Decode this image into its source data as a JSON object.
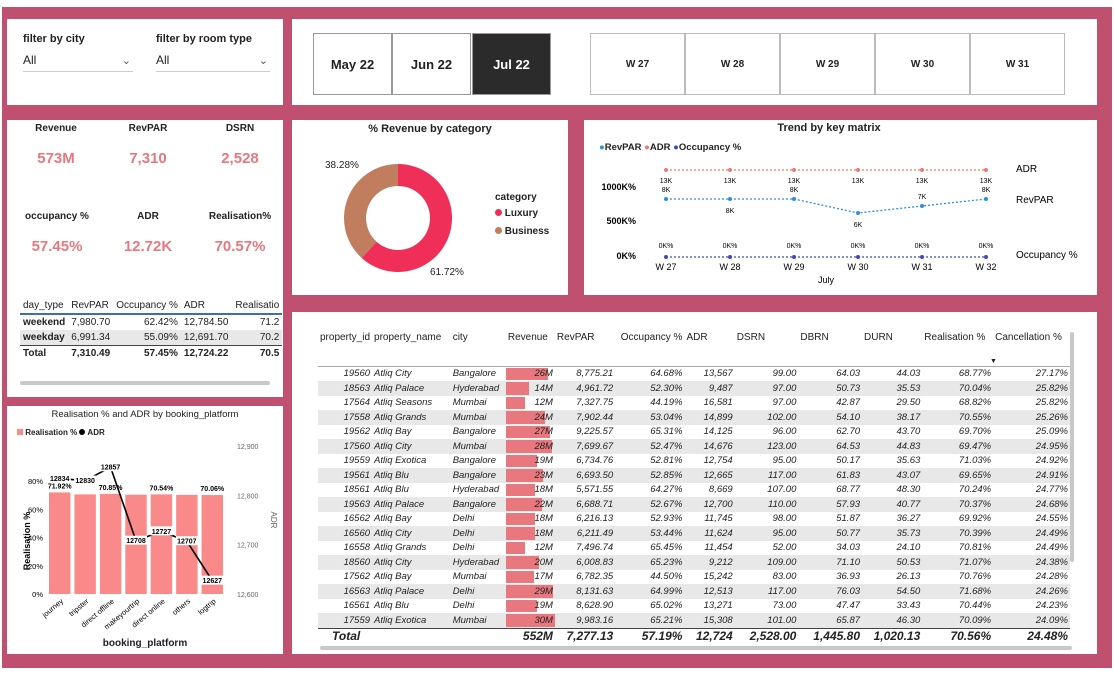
{
  "filters": {
    "city_label": "filter by city",
    "city_value": "All",
    "room_label": "filter by room type",
    "room_value": "All"
  },
  "months": [
    "May 22",
    "Jun 22",
    "Jul 22"
  ],
  "selected_month": "Jul 22",
  "weeks": [
    "W 27",
    "W 28",
    "W 29",
    "W 30",
    "W 31"
  ],
  "kpis": [
    {
      "label": "Revenue",
      "value": "573M"
    },
    {
      "label": "RevPAR",
      "value": "7,310"
    },
    {
      "label": "DSRN",
      "value": "2,528"
    },
    {
      "label": "occupancy %",
      "value": "57.45%"
    },
    {
      "label": "ADR",
      "value": "12.72K"
    },
    {
      "label": "Realisation%",
      "value": "70.57%"
    }
  ],
  "day_type_table": {
    "headers": [
      "day_type",
      "RevPAR",
      "Occupancy %",
      "ADR",
      "Realisatio"
    ],
    "rows": [
      [
        "weekend",
        "7,980.70",
        "62.42%",
        "12,784.50",
        "71.2"
      ],
      [
        "weekday",
        "6,991.34",
        "55.09%",
        "12,691.70",
        "70.2"
      ],
      [
        "Total",
        "7,310.49",
        "57.45%",
        "12,724.22",
        "70.5"
      ]
    ]
  },
  "donut": {
    "title": "% Revenue by category",
    "legend_title": "category",
    "legend": [
      {
        "name": "Luxury",
        "color": "#ef2f58"
      },
      {
        "name": "Business",
        "color": "#c07e5e"
      }
    ],
    "label_business": "38.28%",
    "label_luxury": "61.72%"
  },
  "trend": {
    "title": "Trend by key matrix",
    "legend": [
      {
        "name": "RevPAR",
        "color": "#2b8fe0"
      },
      {
        "name": "ADR",
        "color": "#f07a70"
      },
      {
        "name": "Occupancy %",
        "color": "#3b4dbd"
      }
    ],
    "y_ticks": [
      "1000K%",
      "500K%",
      "0K%"
    ],
    "x_title": "July",
    "right_labels": [
      "ADR",
      "RevPAR",
      "Occupancy %"
    ],
    "adr_labels": [
      "13K",
      "13K",
      "13K",
      "13K",
      "13K",
      "13K"
    ],
    "revpar_labels": [
      "8K",
      "8K",
      "8K",
      "6K",
      "7K",
      "8K"
    ],
    "occ_labels": [
      "0K%",
      "0K%",
      "0K%",
      "0K%",
      "0K%",
      "0K%"
    ]
  },
  "combo": {
    "title": "Realisation % and ADR by booking_platform",
    "legend": [
      {
        "name": "Realisation %",
        "color": "#f98a89"
      },
      {
        "name": "ADR",
        "color": "#000000"
      }
    ],
    "y_ticks": [
      "80%",
      "60%",
      "40%",
      "20%",
      "0%"
    ],
    "y2_ticks": [
      "12,900",
      "12,800",
      "12,700",
      "12,600"
    ],
    "ylabel": "Realisation %",
    "y2label": "ADR",
    "xlabel": "booking_platform",
    "top_labels": [
      "71.92%",
      "70.85%",
      "70.54%",
      "70.06%"
    ],
    "adr_labels": [
      "12834",
      "12830",
      "12857",
      "12708",
      "12727",
      "12707",
      "12627"
    ]
  },
  "chart_data": [
    {
      "type": "pie",
      "title": "% Revenue by category",
      "categories": [
        "Luxury",
        "Business"
      ],
      "values": [
        61.72,
        38.28
      ]
    },
    {
      "type": "line",
      "title": "Trend by key matrix",
      "categories": [
        "W 27",
        "W 28",
        "W 29",
        "W 30",
        "W 31",
        "W 32"
      ],
      "series": [
        {
          "name": "ADR",
          "values": [
            13000,
            13000,
            13000,
            13000,
            13000,
            13000
          ]
        },
        {
          "name": "RevPAR",
          "values": [
            8000,
            8000,
            8000,
            6000,
            7000,
            8000
          ]
        },
        {
          "name": "Occupancy %",
          "values": [
            0,
            0,
            0,
            0,
            0,
            0
          ]
        }
      ],
      "xlabel": "July"
    },
    {
      "type": "bar",
      "title": "Realisation % and ADR by booking_platform",
      "categories": [
        "journey",
        "tripster",
        "direct offline",
        "makeyourtrip",
        "direct online",
        "others",
        "logtrip"
      ],
      "series": [
        {
          "name": "Realisation %",
          "values": [
            71.92,
            70.5,
            70.85,
            70.3,
            70.54,
            70.2,
            70.06
          ]
        },
        {
          "name": "ADR",
          "values": [
            12834,
            12830,
            12857,
            12708,
            12727,
            12707,
            12627
          ]
        }
      ],
      "xlabel": "booking_platform",
      "ylabel": "Realisation %",
      "ylim": [
        0,
        80
      ],
      "y2lim": [
        12600,
        12900
      ]
    }
  ],
  "property_table": {
    "headers": [
      "property_id",
      "property_name",
      "city",
      "Revenue",
      "RevPAR",
      "Occupancy %",
      "ADR",
      "DSRN",
      "DBRN",
      "DURN",
      "Realisation %",
      "Cancellation %"
    ],
    "rows": [
      [
        "19560",
        "Atliq City",
        "Bangalore",
        "26M",
        "8,775.21",
        "64.68%",
        "13,567",
        "99.00",
        "64.03",
        "44.03",
        "68.77%",
        "27.17%"
      ],
      [
        "18563",
        "Atliq Palace",
        "Hyderabad",
        "14M",
        "4,961.72",
        "52.30%",
        "9,487",
        "97.00",
        "50.73",
        "35.53",
        "70.04%",
        "25.82%"
      ],
      [
        "17564",
        "Atliq Seasons",
        "Mumbai",
        "12M",
        "7,327.75",
        "44.19%",
        "16,581",
        "97.00",
        "42.87",
        "29.50",
        "68.82%",
        "25.82%"
      ],
      [
        "17558",
        "Atliq Grands",
        "Mumbai",
        "24M",
        "7,902.44",
        "53.04%",
        "14,899",
        "102.00",
        "54.10",
        "38.17",
        "70.55%",
        "25.26%"
      ],
      [
        "19562",
        "Atliq Bay",
        "Bangalore",
        "27M",
        "9,225.57",
        "65.31%",
        "14,125",
        "96.00",
        "62.70",
        "43.70",
        "69.70%",
        "25.09%"
      ],
      [
        "17560",
        "Atliq City",
        "Mumbai",
        "28M",
        "7,699.67",
        "52.47%",
        "14,676",
        "123.00",
        "64.53",
        "44.83",
        "69.47%",
        "24.95%"
      ],
      [
        "19559",
        "Atliq Exotica",
        "Bangalore",
        "19M",
        "6,734.76",
        "52.81%",
        "12,754",
        "95.00",
        "50.17",
        "35.63",
        "71.03%",
        "24.92%"
      ],
      [
        "19561",
        "Atliq Blu",
        "Bangalore",
        "23M",
        "6,693.50",
        "52.85%",
        "12,665",
        "117.00",
        "61.83",
        "43.07",
        "69.65%",
        "24.91%"
      ],
      [
        "18561",
        "Atliq Blu",
        "Hyderabad",
        "18M",
        "5,571.55",
        "64.27%",
        "8,669",
        "107.00",
        "68.77",
        "48.30",
        "70.24%",
        "24.77%"
      ],
      [
        "19563",
        "Atliq Palace",
        "Bangalore",
        "22M",
        "6,688.71",
        "52.67%",
        "12,700",
        "110.00",
        "57.93",
        "40.77",
        "70.37%",
        "24.68%"
      ],
      [
        "16562",
        "Atliq Bay",
        "Delhi",
        "18M",
        "6,216.13",
        "52.93%",
        "11,745",
        "98.00",
        "51.87",
        "36.27",
        "69.92%",
        "24.55%"
      ],
      [
        "16560",
        "Atliq City",
        "Delhi",
        "18M",
        "6,211.49",
        "53.44%",
        "11,624",
        "95.00",
        "50.77",
        "35.73",
        "70.39%",
        "24.49%"
      ],
      [
        "16558",
        "Atliq Grands",
        "Delhi",
        "12M",
        "7,496.74",
        "65.45%",
        "11,454",
        "52.00",
        "34.03",
        "24.10",
        "70.81%",
        "24.49%"
      ],
      [
        "18560",
        "Atliq City",
        "Hyderabad",
        "20M",
        "6,008.83",
        "65.23%",
        "9,212",
        "109.00",
        "71.10",
        "50.53",
        "71.07%",
        "24.38%"
      ],
      [
        "17562",
        "Atliq Bay",
        "Mumbai",
        "17M",
        "6,782.35",
        "44.50%",
        "15,242",
        "83.00",
        "36.93",
        "26.13",
        "70.76%",
        "24.28%"
      ],
      [
        "16563",
        "Atliq Palace",
        "Delhi",
        "29M",
        "8,131.63",
        "64.99%",
        "12,513",
        "117.00",
        "76.03",
        "54.50",
        "71.68%",
        "24.26%"
      ],
      [
        "16561",
        "Atliq Blu",
        "Delhi",
        "19M",
        "8,628.90",
        "65.02%",
        "13,271",
        "73.00",
        "47.47",
        "33.43",
        "70.44%",
        "24.23%"
      ],
      [
        "17559",
        "Atliq Exotica",
        "Mumbai",
        "30M",
        "9,983.16",
        "65.21%",
        "15,308",
        "101.00",
        "65.87",
        "46.30",
        "70.09%",
        "24.09%"
      ]
    ],
    "total": [
      "Total",
      "552M",
      "7,277.13",
      "57.19%",
      "12,724",
      "2,528.00",
      "1,445.80",
      "1,020.13",
      "70.56%",
      "24.48%"
    ]
  }
}
